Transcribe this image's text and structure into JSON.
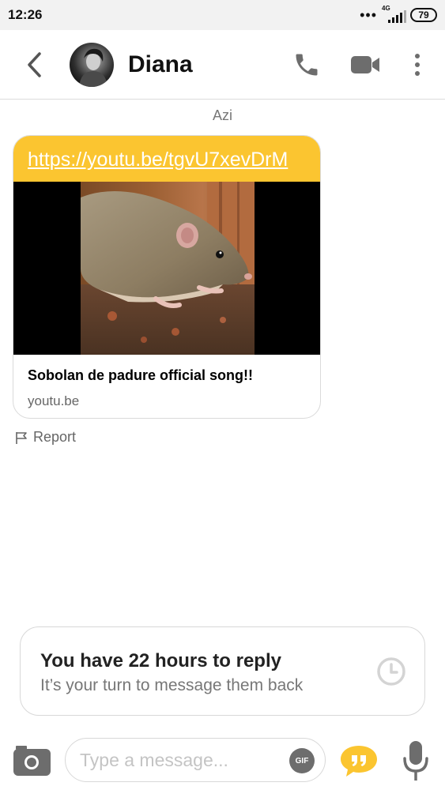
{
  "status_bar": {
    "time": "12:26",
    "network": "4G",
    "battery": "79"
  },
  "header": {
    "contact_name": "Diana"
  },
  "conversation": {
    "date_separator": "Azi",
    "link_message": {
      "url": "https://youtu.be/tgvU7xevDrM",
      "preview_title": "Sobolan de padure official song!!",
      "preview_domain": "youtu.be"
    },
    "report_label": "Report"
  },
  "reply_notice": {
    "title": "You have 22 hours to reply",
    "subtitle": "It’s your turn to message them back"
  },
  "composer": {
    "placeholder": "Type a message...",
    "gif_label": "GIF"
  },
  "colors": {
    "accent": "#fbc530",
    "text_primary": "#222222",
    "text_secondary": "#777777",
    "icon_gray": "#6d6d6d"
  }
}
